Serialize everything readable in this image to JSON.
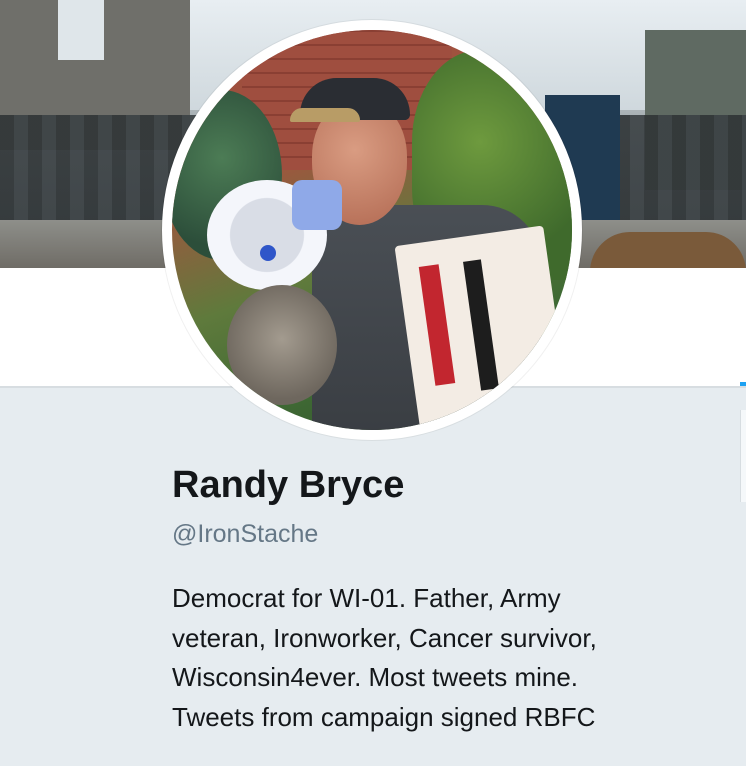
{
  "profile": {
    "name": "Randy Bryce",
    "handle": "@IronStache",
    "bio_lines": [
      "Democrat for WI-01. Father, Army",
      "veteran, Ironworker, Cancer survivor,",
      "Wisconsin4ever. Most tweets mine.",
      "Tweets from campaign signed RBFC"
    ]
  },
  "colors": {
    "page_background": "#e6ecf0",
    "name_text": "#14171a",
    "handle_text": "#657786",
    "accent": "#1da1f2"
  }
}
